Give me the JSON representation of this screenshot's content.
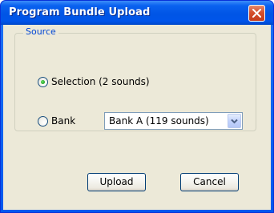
{
  "window": {
    "title": "Program Bundle Upload",
    "close_icon": "close-icon"
  },
  "source_group": {
    "legend": "Source",
    "selection_option": {
      "label": "Selection (2 sounds)",
      "checked": true
    },
    "bank_option": {
      "label": "Bank",
      "checked": false
    },
    "bank_select": {
      "value": "Bank A (119 sounds)"
    }
  },
  "buttons": {
    "upload_label": "Upload",
    "cancel_label": "Cancel"
  },
  "colors": {
    "titlebar": "#0055e5",
    "dialog_bg": "#ece9d8",
    "legend_text": "#0046d5",
    "close_button": "#d5502d"
  }
}
